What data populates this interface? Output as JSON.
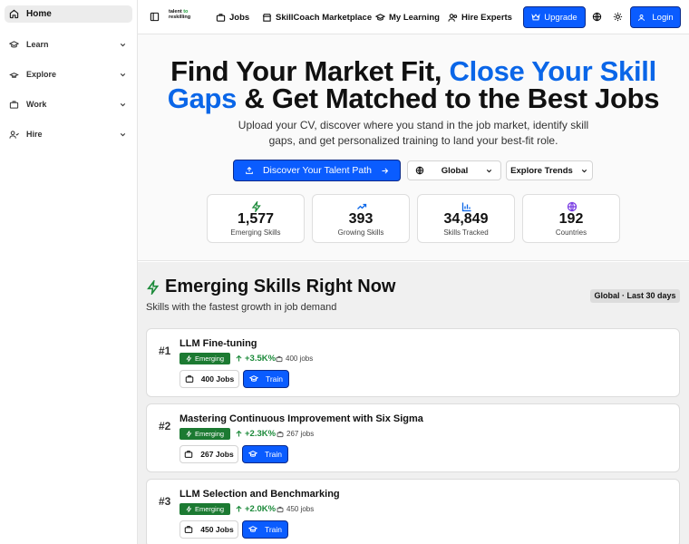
{
  "sidebar": {
    "items": [
      {
        "label": "Home",
        "icon": "home-icon"
      },
      {
        "label": "Learn",
        "icon": "graduation-cap-icon"
      },
      {
        "label": "Explore",
        "icon": "compass-icon"
      },
      {
        "label": "Work",
        "icon": "briefcase-icon"
      },
      {
        "label": "Hire",
        "icon": "users-icon"
      }
    ]
  },
  "topbar": {
    "logo_line1": "talent",
    "logo_line1_accent": "to",
    "logo_line2": "reskilling",
    "nav": [
      {
        "label": "Jobs",
        "icon": "briefcase-icon"
      },
      {
        "label": "SkillCoach Marketplace",
        "icon": "store-icon"
      },
      {
        "label": "My Learning",
        "icon": "graduation-cap-icon"
      },
      {
        "label": "Hire Experts",
        "icon": "users-icon"
      }
    ],
    "upgrade_label": "Upgrade",
    "login_label": "Login"
  },
  "hero": {
    "title_part1": "Find Your Market Fit, ",
    "title_accent": "Close Your Skill Gaps",
    "title_part2": " & Get Matched to the Best Jobs",
    "subtitle": "Upload your CV, discover where you stand in the job market, identify skill gaps, and get personalized training to land your best-fit role.",
    "discover_label": "Discover Your Talent Path",
    "region_value": "Global",
    "explore_label": "Explore Trends"
  },
  "stats": [
    {
      "value": "1,577",
      "label": "Emerging Skills",
      "icon": "zap-icon",
      "color": "#1c8a3a"
    },
    {
      "value": "393",
      "label": "Growing Skills",
      "icon": "trending-up-icon",
      "color": "#0a66e8"
    },
    {
      "value": "34,849",
      "label": "Skills Tracked",
      "icon": "bar-chart-icon",
      "color": "#0a66e8"
    },
    {
      "value": "192",
      "label": "Countries",
      "icon": "globe-icon",
      "color": "#7b3fe4"
    }
  ],
  "emerging": {
    "title": "Emerging Skills Right Now",
    "subtitle": "Skills with the fastest growth in job demand",
    "badge": "Global · Last 30 days",
    "skills": [
      {
        "rank": "#1",
        "name": "LLM Fine-tuning",
        "tag": "Emerging",
        "growth": "+3.5K%",
        "jobs": "400 jobs",
        "jobs_btn": "400 Jobs",
        "train_label": "Train"
      },
      {
        "rank": "#2",
        "name": "Mastering Continuous Improvement with Six Sigma",
        "tag": "Emerging",
        "growth": "+2.3K%",
        "jobs": "267 jobs",
        "jobs_btn": "267 Jobs",
        "train_label": "Train"
      },
      {
        "rank": "#3",
        "name": "LLM Selection and Benchmarking",
        "tag": "Emerging",
        "growth": "+2.0K%",
        "jobs": "450 jobs",
        "jobs_btn": "450 Jobs",
        "train_label": "Train"
      }
    ]
  }
}
